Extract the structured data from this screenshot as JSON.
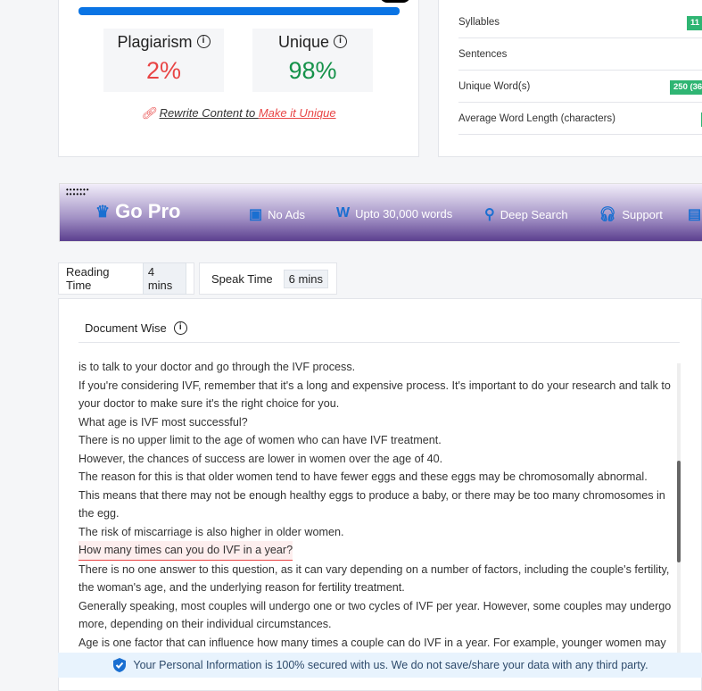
{
  "progress": {
    "percent": 100,
    "color": "#0a74e4"
  },
  "results": {
    "plagiarism": {
      "label": "Plagiarism",
      "value": "2%",
      "color": "#e84545"
    },
    "unique": {
      "label": "Unique",
      "value": "98%",
      "color": "#15924a"
    },
    "rewrite_prefix": "Rewrite Content to ",
    "rewrite_link": "Make it Unique"
  },
  "stats": [
    {
      "label": "Syllables",
      "badge": "11"
    },
    {
      "label": "Sentences",
      "badge": ""
    },
    {
      "label": "Unique Word(s)",
      "badge": "250 (36"
    },
    {
      "label": "Average Word Length (characters)",
      "badge": ""
    }
  ],
  "gopro": {
    "title": "Go Pro",
    "features": [
      "No Ads",
      "Upto 30,000 words",
      "Deep Search",
      "Support"
    ]
  },
  "times": {
    "reading_label": "Reading Time",
    "reading_value": "4 mins",
    "speak_label": "Speak Time",
    "speak_value": "6 mins"
  },
  "document": {
    "title": "Document Wise",
    "lines": [
      "is to talk to your doctor and go through the IVF process.",
      "If you're considering IVF, remember that it's a long and expensive process. It's important to do your research and talk to your doctor to make sure it's the right choice for you.",
      "What age is IVF most successful?",
      "There is no upper limit to the age of women who can have IVF treatment.",
      "However, the chances of success are lower in women over the age of 40.",
      "The reason for this is that older women tend to have fewer eggs and these eggs may be chromosomally abnormal.",
      "This means that there may not be enough healthy eggs to produce a baby, or there may be too many chromosomes in the egg.",
      "The risk of miscarriage is also higher in older women.",
      "How many times can you do IVF in a year?",
      "There is no one answer to this question, as it can vary depending on a number of factors, including the couple's fertility, the woman's age, and the underlying reason for fertility treatment.",
      "Generally speaking, most couples will undergo one or two cycles of IVF per year. However, some couples may undergo more, depending on their individual circumstances.",
      "Age is one factor that can influence how many times a couple can do IVF in a year. For example, younger women may"
    ],
    "highlighted_index": 8
  },
  "secure_notice": "Your Personal Information is 100% secured with us. We do not save/share your data with any third party."
}
